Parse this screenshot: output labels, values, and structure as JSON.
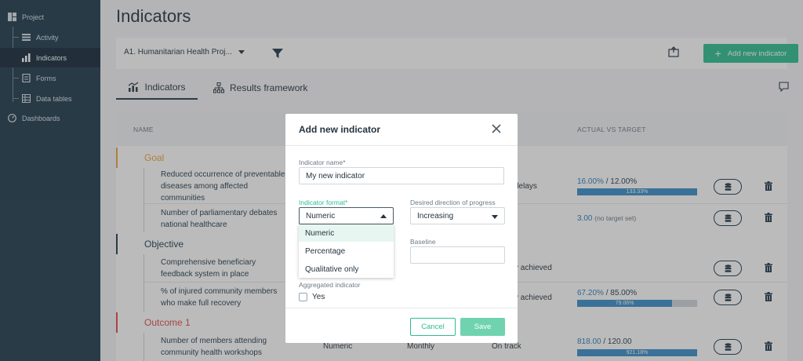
{
  "sidebar": {
    "items": [
      {
        "label": "Project",
        "icon": "project-icon"
      },
      {
        "label": "Activity",
        "icon": "activity-icon"
      },
      {
        "label": "Indicators",
        "icon": "indicators-icon",
        "active": true
      },
      {
        "label": "Forms",
        "icon": "forms-icon"
      },
      {
        "label": "Data tables",
        "icon": "data-tables-icon"
      },
      {
        "label": "Dashboards",
        "icon": "dashboards-icon"
      }
    ]
  },
  "page": {
    "title": "Indicators"
  },
  "toolbar": {
    "project_select": "A1. Humanitarian Health Proj...",
    "add_button": "Add new indicator"
  },
  "tabs": [
    {
      "label": "Indicators",
      "active": true
    },
    {
      "label": "Results framework",
      "active": false
    }
  ],
  "table": {
    "headers": {
      "name": "NAME",
      "actual_vs_target": "ACTUAL VS TARGET"
    },
    "groups": [
      {
        "label": "Goal",
        "color": "#e8a33d"
      },
      {
        "label": "Objective",
        "color": "#1f3a4d"
      },
      {
        "label": "Outcome 1",
        "color": "#e04b4b"
      }
    ],
    "rows": [
      {
        "name": "Reduced occurrence of preventable diseases among affected communities",
        "status": "delays",
        "actual": "16.00%",
        "target": "/ 12.00%",
        "bar_label": "133.33%",
        "progress": 1.0
      },
      {
        "name": "Number of parliamentary debates national healthcare",
        "actual": "3.00",
        "target": "(no target set)"
      },
      {
        "name": "Comprehensive beneficiary feedback system in place",
        "status": "y achieved"
      },
      {
        "name": "% of injured community members who make full recovery",
        "status": "y achieved",
        "actual": "67.20%",
        "target": "/ 85.00%",
        "bar_label": "79.06%",
        "progress": 0.7906
      },
      {
        "name": "Number of members attending community health workshops",
        "format": "Numeric",
        "frequency": "Monthly",
        "status": "On track",
        "actual": "818.00",
        "target": "/ 120.00",
        "bar_label": "921.18%",
        "progress": 1.0
      }
    ]
  },
  "modal": {
    "title": "Add new indicator",
    "name_label": "Indicator name*",
    "name_value": "My new indicator",
    "format_label": "Indicator format*",
    "format_value": "Numeric",
    "format_options": [
      "Numeric",
      "Percentage",
      "Qualitative only"
    ],
    "direction_label": "Desired direction of progress",
    "direction_value": "Increasing",
    "baseline_label": "Baseline",
    "baseline_value": "",
    "aggregated_label": "Aggregated indicator",
    "aggregated_checkbox_label": "Yes",
    "cancel": "Cancel",
    "save": "Save"
  },
  "colors": {
    "sidebar": "#1f3a4d",
    "accent": "#2bbf8f",
    "bar": "#3a8ec9"
  }
}
